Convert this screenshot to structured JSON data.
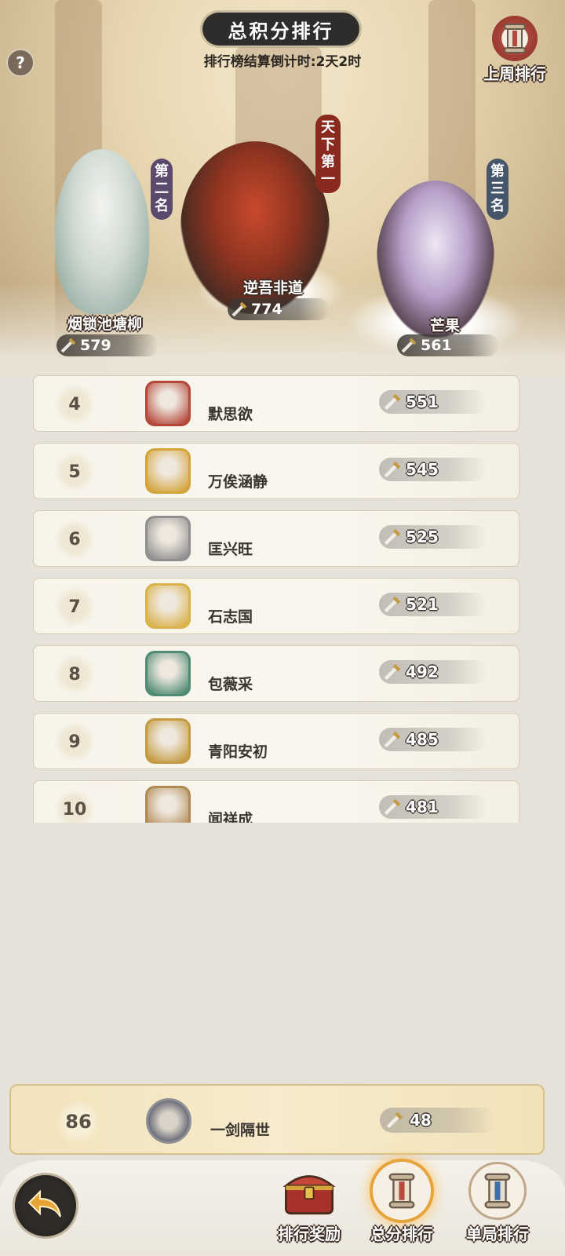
{
  "header": {
    "title": "总积分排行",
    "countdown": "排行榜结算倒计时:2天2时",
    "help_label": "?",
    "last_week_label": "上周排行"
  },
  "podium": {
    "first": {
      "tag": "天下第一",
      "name": "逆吾非道",
      "score": "774"
    },
    "second": {
      "tag": "第二名",
      "name": "烟锁池塘柳",
      "score": "579"
    },
    "third": {
      "tag": "第三名",
      "name": "芒果",
      "score": "561"
    }
  },
  "rankings": [
    {
      "rank": "4",
      "name": "默思欲",
      "score": "551",
      "frame": "#b4473a"
    },
    {
      "rank": "5",
      "name": "万俟涵静",
      "score": "545",
      "frame": "#d4a43c"
    },
    {
      "rank": "6",
      "name": "匡兴旺",
      "score": "525",
      "frame": "#8f8f8f"
    },
    {
      "rank": "7",
      "name": "石志国",
      "score": "521",
      "frame": "#d9b24a"
    },
    {
      "rank": "8",
      "name": "包薇采",
      "score": "492",
      "frame": "#4f8a73"
    },
    {
      "rank": "9",
      "name": "青阳安初",
      "score": "485",
      "frame": "#c49a42"
    },
    {
      "rank": "10",
      "name": "闻祥成",
      "score": "481",
      "frame": "#b08a55"
    }
  ],
  "me": {
    "rank": "86",
    "name": "一剑隔世",
    "score": "48"
  },
  "nav": {
    "rewards_label": "排行奖励",
    "total_label": "总分排行",
    "single_label": "单局排行"
  },
  "icons": {
    "score": "sword-icon",
    "back": "back-arrow-icon",
    "rewards": "treasure-chest-icon",
    "scroll": "scroll-icon"
  },
  "colors": {
    "accent_gold": "#e8a43c",
    "dark_banner": "#2f2d2b",
    "first_tag": "#8a2a1e"
  }
}
